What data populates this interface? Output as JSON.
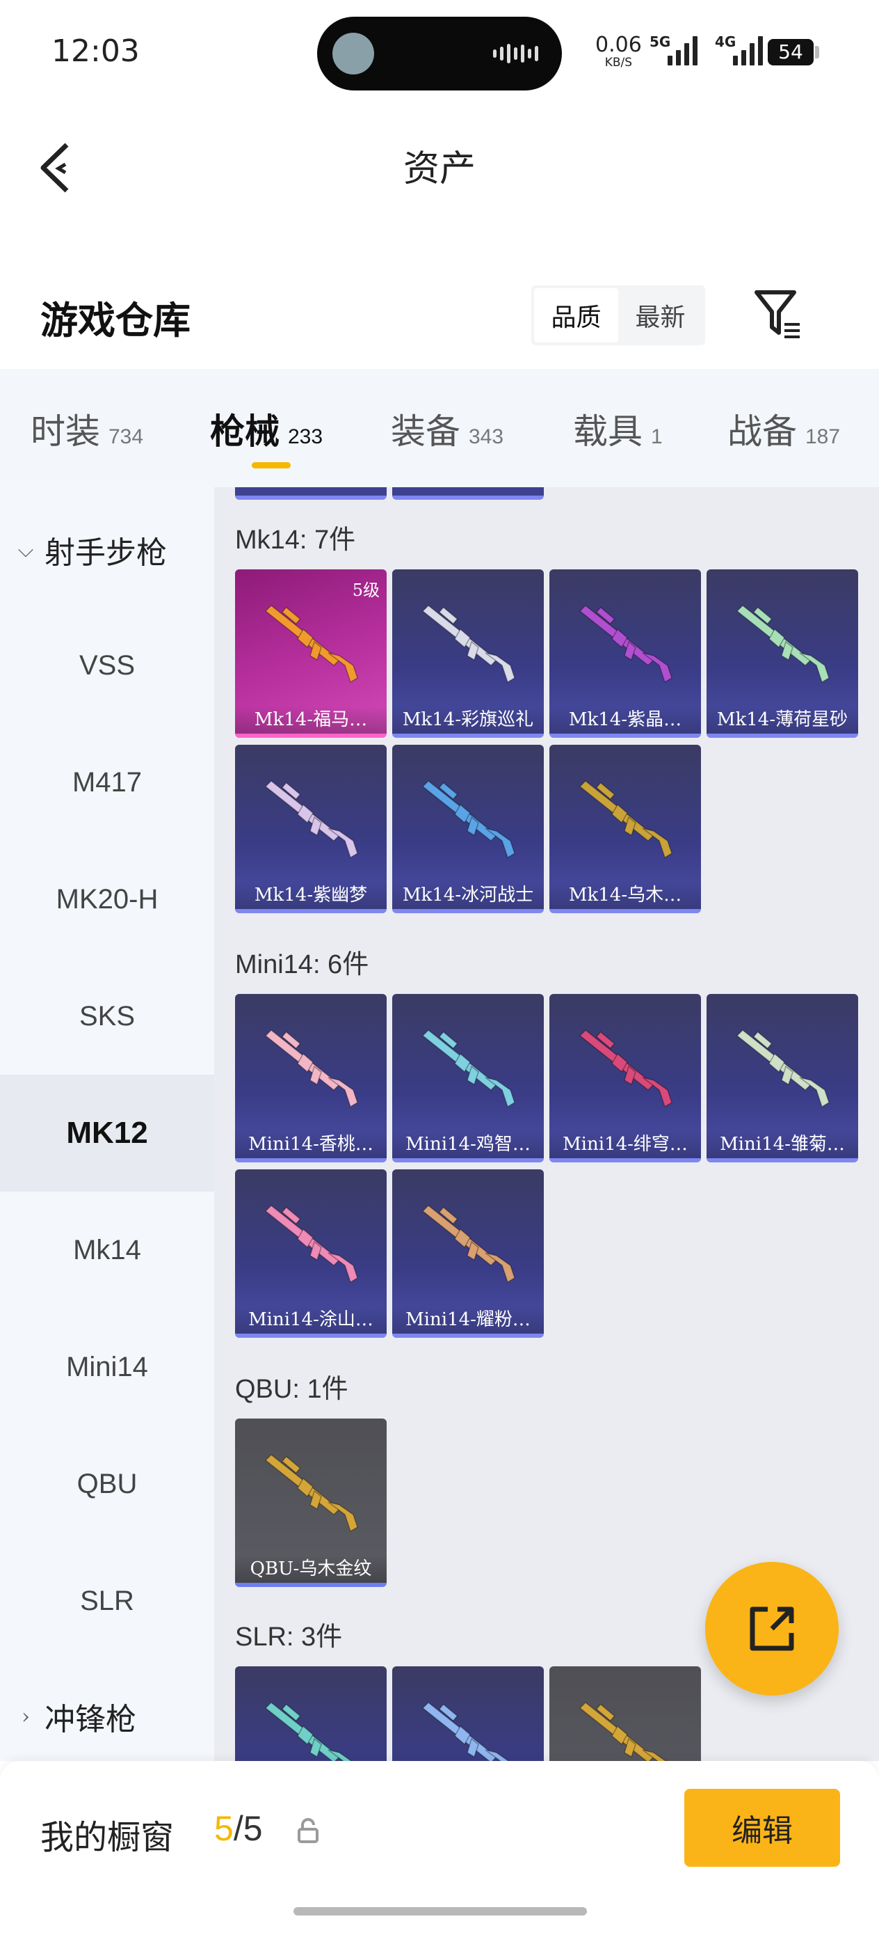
{
  "status_bar": {
    "time": "12:03",
    "net_speed_value": "0.06",
    "net_speed_unit": "KB/S",
    "signal_1_label": "5G",
    "signal_2_label": "4G",
    "battery": "54"
  },
  "header": {
    "title": "资产"
  },
  "warehouse": {
    "title": "游戏仓库",
    "sort_options": [
      "品质",
      "最新"
    ],
    "sort_active": "品质"
  },
  "tabs": [
    {
      "name": "时装",
      "count": "734"
    },
    {
      "name": "枪械",
      "count": "233"
    },
    {
      "name": "装备",
      "count": "343"
    },
    {
      "name": "载具",
      "count": "1"
    },
    {
      "name": "战备",
      "count": "187"
    }
  ],
  "active_tab": "枪械",
  "sidebar": {
    "group_open": "射手步枪",
    "items": [
      "VSS",
      "M417",
      "MK20-H",
      "SKS",
      "MK12",
      "Mk14",
      "Mini14",
      "QBU",
      "SLR"
    ],
    "active_item": "MK12",
    "group_next": "冲锋枪"
  },
  "sections": [
    {
      "title": "Mk14: 7件",
      "items": [
        {
          "label": "Mk14-福马…",
          "level": "5级",
          "style": "pink",
          "gun_color": "#f29a2e"
        },
        {
          "label": "Mk14-彩旗巡礼",
          "style": "purple",
          "gun_color": "#d9dbe8"
        },
        {
          "label": "Mk14-紫晶…",
          "style": "purple",
          "gun_color": "#b04fd0"
        },
        {
          "label": "Mk14-薄荷星砂",
          "style": "purple",
          "gun_color": "#a7e0b8"
        },
        {
          "label": "Mk14-紫幽梦",
          "style": "purple",
          "gun_color": "#d9c4ea"
        },
        {
          "label": "Mk14-冰河战士",
          "style": "purple",
          "gun_color": "#5aa3e6"
        },
        {
          "label": "Mk14-乌木…",
          "style": "purple",
          "gun_color": "#c9a33a"
        }
      ]
    },
    {
      "title": "Mini14: 6件",
      "items": [
        {
          "label": "Mini14-香桃…",
          "style": "purple",
          "gun_color": "#f2b6c6"
        },
        {
          "label": "Mini14-鸡智…",
          "style": "purple",
          "gun_color": "#7fd0e0"
        },
        {
          "label": "Mini14-绯穹…",
          "style": "purple",
          "gun_color": "#d94a7a"
        },
        {
          "label": "Mini14-雏菊…",
          "style": "purple",
          "gun_color": "#cfe0c8"
        },
        {
          "label": "Mini14-涂山…",
          "style": "purple",
          "gun_color": "#f08ab6"
        },
        {
          "label": "Mini14-耀粉…",
          "style": "purple",
          "gun_color": "#d9a070"
        }
      ]
    },
    {
      "title": "QBU: 1件",
      "items": [
        {
          "label": "QBU-乌木金纹",
          "style": "grey",
          "gun_color": "#d4a63a"
        }
      ]
    },
    {
      "title": "SLR: 3件",
      "items": [
        {
          "label": "",
          "style": "purple",
          "gun_color": "#6fd0c8"
        },
        {
          "label": "",
          "style": "purple",
          "gun_color": "#8fb6f0"
        },
        {
          "label": "",
          "style": "grey",
          "gun_color": "#d4a63a"
        }
      ]
    }
  ],
  "bottom_bar": {
    "window_label": "我的橱窗",
    "window_current": "5",
    "window_total": "/5",
    "edit_label": "编辑"
  }
}
